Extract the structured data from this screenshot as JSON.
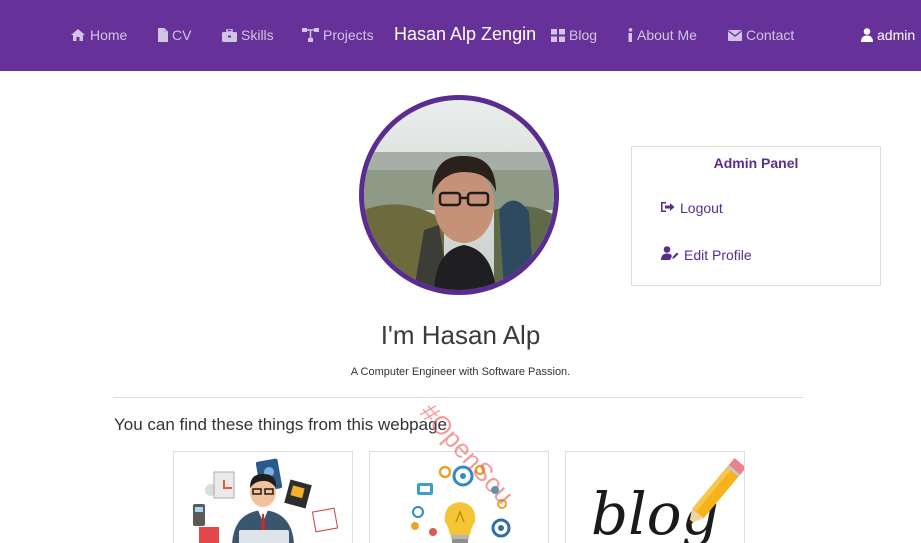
{
  "nav": {
    "home": "Home",
    "cv": "CV",
    "skills": "Skills",
    "projects": "Projects",
    "brand": "Hasan Alp Zengin",
    "blog": "Blog",
    "about": "About Me",
    "contact": "Contact",
    "user": "admin"
  },
  "admin_panel": {
    "title": "Admin Panel",
    "logout": "Logout",
    "edit_profile": "Edit Profile"
  },
  "hero": {
    "name": "I'm Hasan Alp",
    "subtitle": "A Computer Engineer with Software Passion."
  },
  "section": {
    "title": "You can find these things from this webpage"
  },
  "cards": {
    "blog_word": "blog"
  },
  "watermark": "#OpenSou",
  "colors": {
    "navbar": "#66329a",
    "nav_text": "#d2c4e3",
    "accent": "#5a2d91"
  },
  "icons": {
    "home": "home-icon",
    "cv": "file-icon",
    "skills": "briefcase-icon",
    "projects": "sitemap-icon",
    "blog": "grid-icon",
    "about": "info-icon",
    "contact": "envelope-icon",
    "user": "user-icon",
    "logout": "sign-out-icon",
    "edit": "user-edit-icon"
  }
}
